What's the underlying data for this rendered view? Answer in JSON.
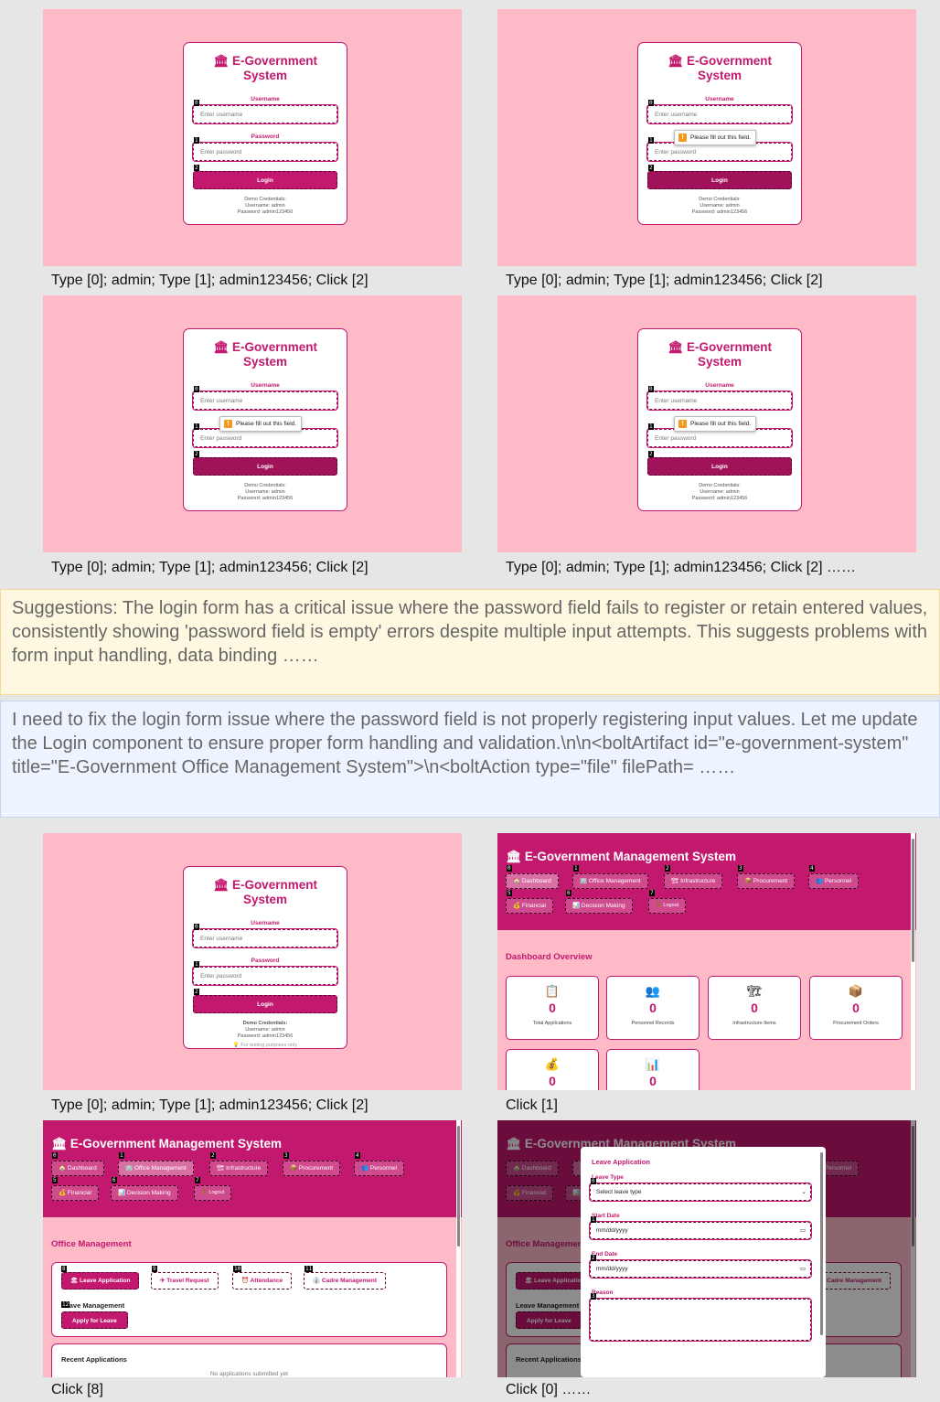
{
  "login": {
    "title_line1": "E-Government",
    "title_line2": "System",
    "username_label": "Username",
    "username_placeholder": "Enter username",
    "password_label": "Password",
    "password_placeholder": "Enter password",
    "login_button": "Login",
    "demo_heading": "Demo Credentials:",
    "demo_username": "Username: admin",
    "demo_password": "Password: admin123456",
    "testing_note": "For testing purposes only",
    "tooltip": "Please fill out this field."
  },
  "captions": {
    "c1": "Type [0]; admin; Type [1]; admin123456; Click [2]",
    "c2": "Type [0]; admin; Type [1]; admin123456; Click [2]",
    "c3": "Type [0]; admin; Type [1]; admin123456; Click [2]",
    "c4": "Type [0]; admin; Type [1]; admin123456; Click [2] ……",
    "c5": "Type [0]; admin; Type [1]; admin123456; Click [2]",
    "c6": "Click [1]",
    "c7": "Click [8]",
    "c8": "Click [0] ……"
  },
  "suggestions": "Suggestions: The login form has a critical issue where the password field fails to register or retain entered values, consistently showing 'password field is empty' errors despite multiple input attempts. This suggests problems with form input handling, data binding ……",
  "response": "I need to fix the login form issue where the password field is not properly registering input values. Let me update the Login component to ensure proper form handling and validation.\\n\\n<boltArtifact id=\"e-government-system\" title=\"E-Government Office Management System\">\\n<boltAction type=\"file\" filePath= ……",
  "dashboard": {
    "app_title": "E-Government Management System",
    "nav": [
      "Dashboard",
      "Office Management",
      "Infrastructure",
      "Procurement",
      "Personnel",
      "Financial",
      "Decision Making",
      "Logout"
    ],
    "overview_title": "Dashboard Overview",
    "stats": [
      {
        "icon": "clipboard-icon",
        "value": "0",
        "label": "Total Applications"
      },
      {
        "icon": "people-icon",
        "value": "0",
        "label": "Personnel Records"
      },
      {
        "icon": "crane-icon",
        "value": "0",
        "label": "Infrastructure Items"
      },
      {
        "icon": "package-icon",
        "value": "0",
        "label": "Procurement Orders"
      },
      {
        "icon": "money-bag-icon",
        "value": "0",
        "label": ""
      },
      {
        "icon": "bar-chart-icon",
        "value": "0",
        "label": ""
      }
    ]
  },
  "office": {
    "title": "Office Management",
    "tabs": [
      "Leave Application",
      "Travel Request",
      "Attendance",
      "Cadre Management"
    ],
    "leave_heading": "Leave Management",
    "apply_button": "Apply for Leave",
    "recent_heading": "Recent Applications",
    "empty_text": "No applications submitted yet"
  },
  "modal": {
    "title": "Leave Application",
    "leave_type_label": "Leave Type",
    "leave_type_value": "Select leave type",
    "start_label": "Start Date",
    "end_label": "End Date",
    "date_placeholder": "mm/dd/yyyy",
    "reason_label": "Reason"
  },
  "colors": {
    "accent": "#c2196f",
    "background": "#ffbac8",
    "suggestion_bg": "#fff8e1",
    "response_bg": "#eef4ff"
  }
}
